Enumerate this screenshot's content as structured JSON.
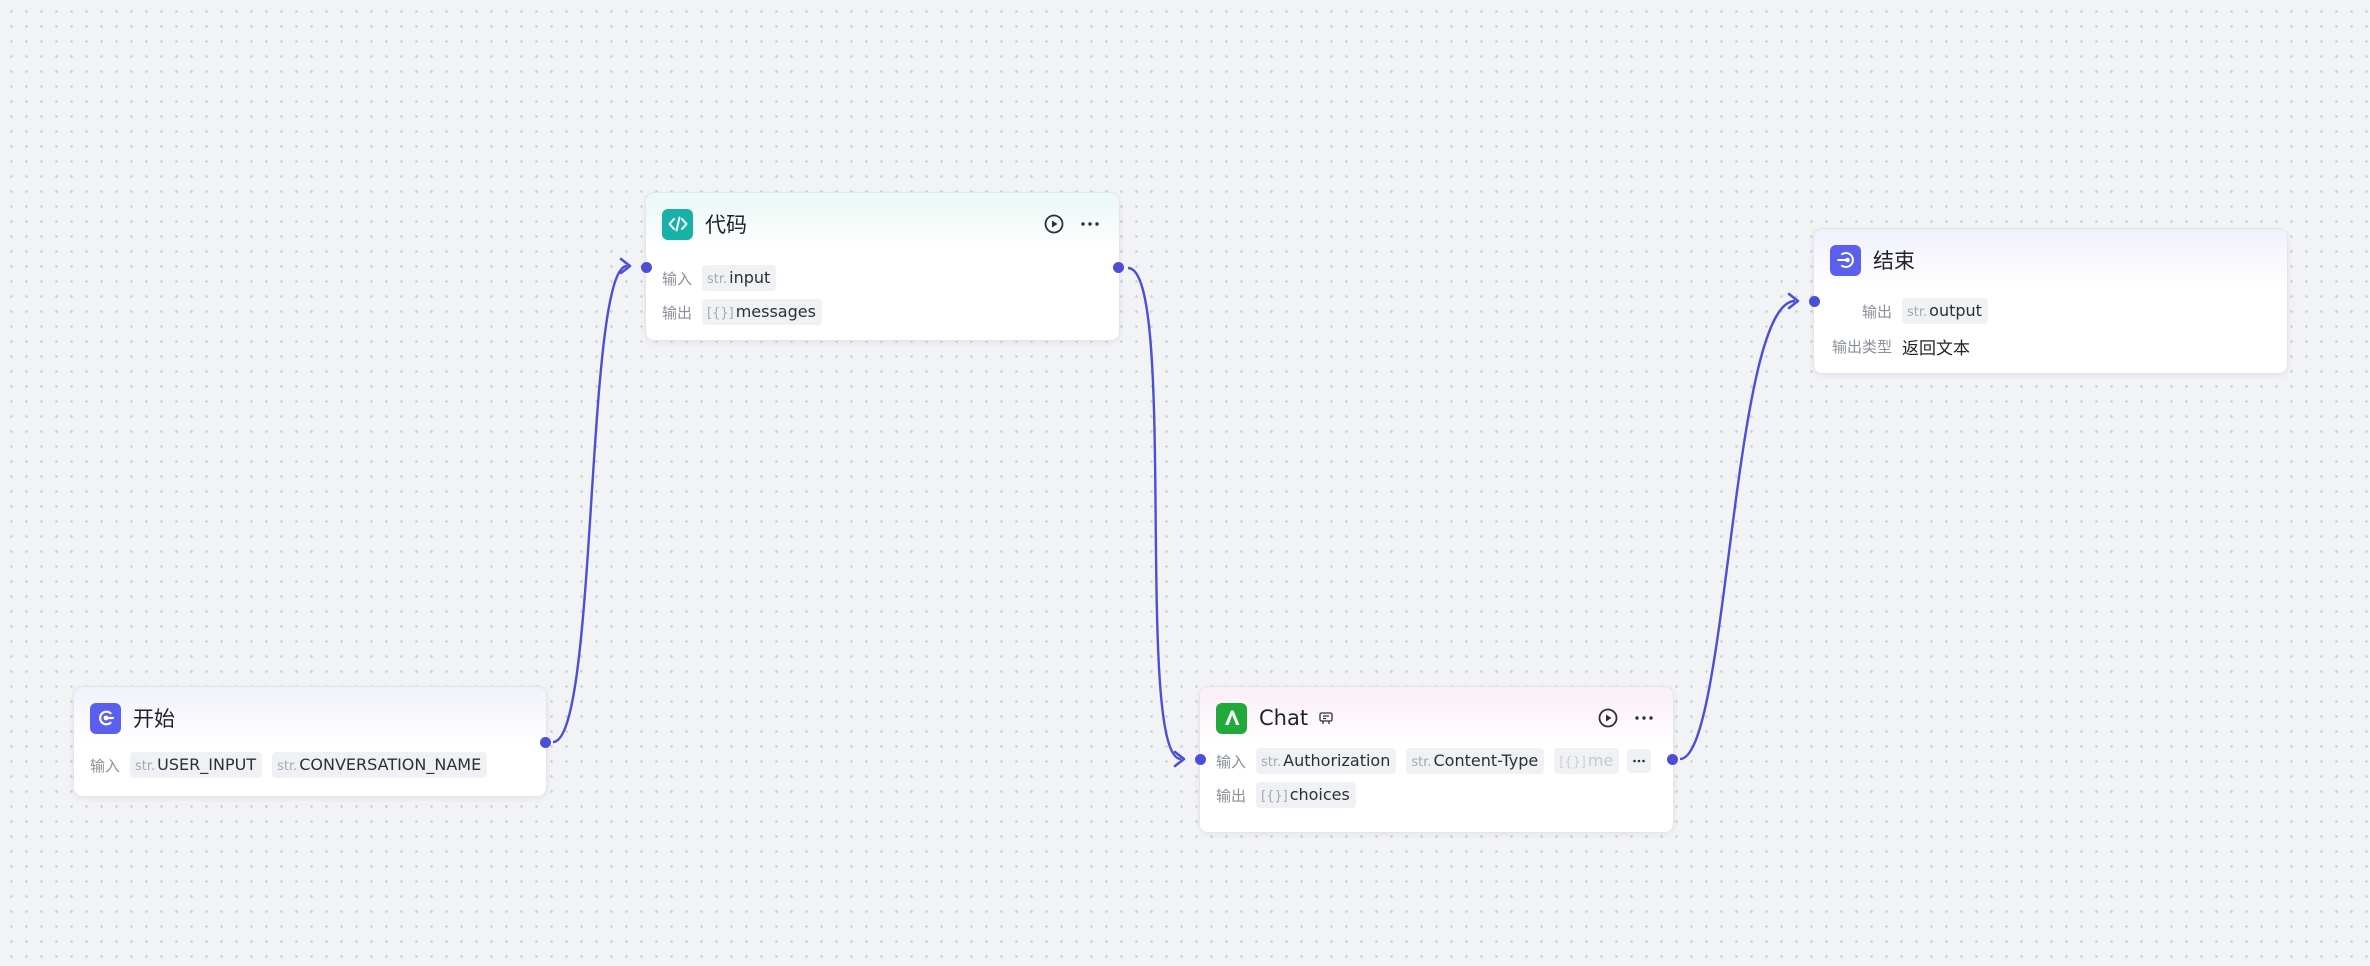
{
  "colors": {
    "edge": "#4b4fd6",
    "start_icon": "#5b5ff0",
    "code_icon": "#18b1a8",
    "chat_icon": "#1faa3a",
    "end_icon": "#5b5ff0"
  },
  "nodes": {
    "start": {
      "title": "开始",
      "icon": "start-icon",
      "input_label": "输入",
      "inputs": [
        {
          "type": "str.",
          "name": "USER_INPUT"
        },
        {
          "type": "str.",
          "name": "CONVERSATION_NAME"
        }
      ]
    },
    "code": {
      "title": "代码",
      "icon": "code-icon",
      "input_label": "输入",
      "output_label": "输出",
      "inputs": [
        {
          "type": "str.",
          "name": "input"
        }
      ],
      "outputs": [
        {
          "type": "[{}]",
          "name": "messages"
        }
      ]
    },
    "chat": {
      "title": "Chat",
      "icon": "llm-a-icon",
      "input_label": "输入",
      "output_label": "输出",
      "inputs": [
        {
          "type": "str.",
          "name": "Authorization"
        },
        {
          "type": "str.",
          "name": "Content-Type"
        },
        {
          "type": "[{}]",
          "name": "me"
        }
      ],
      "outputs": [
        {
          "type": "[{}]",
          "name": "choices"
        }
      ]
    },
    "end": {
      "title": "结束",
      "icon": "end-icon",
      "output_label": "输出",
      "outputs": [
        {
          "type": "str.",
          "name": "output"
        }
      ],
      "output_type_label": "输出类型",
      "output_type_value": "返回文本"
    }
  }
}
